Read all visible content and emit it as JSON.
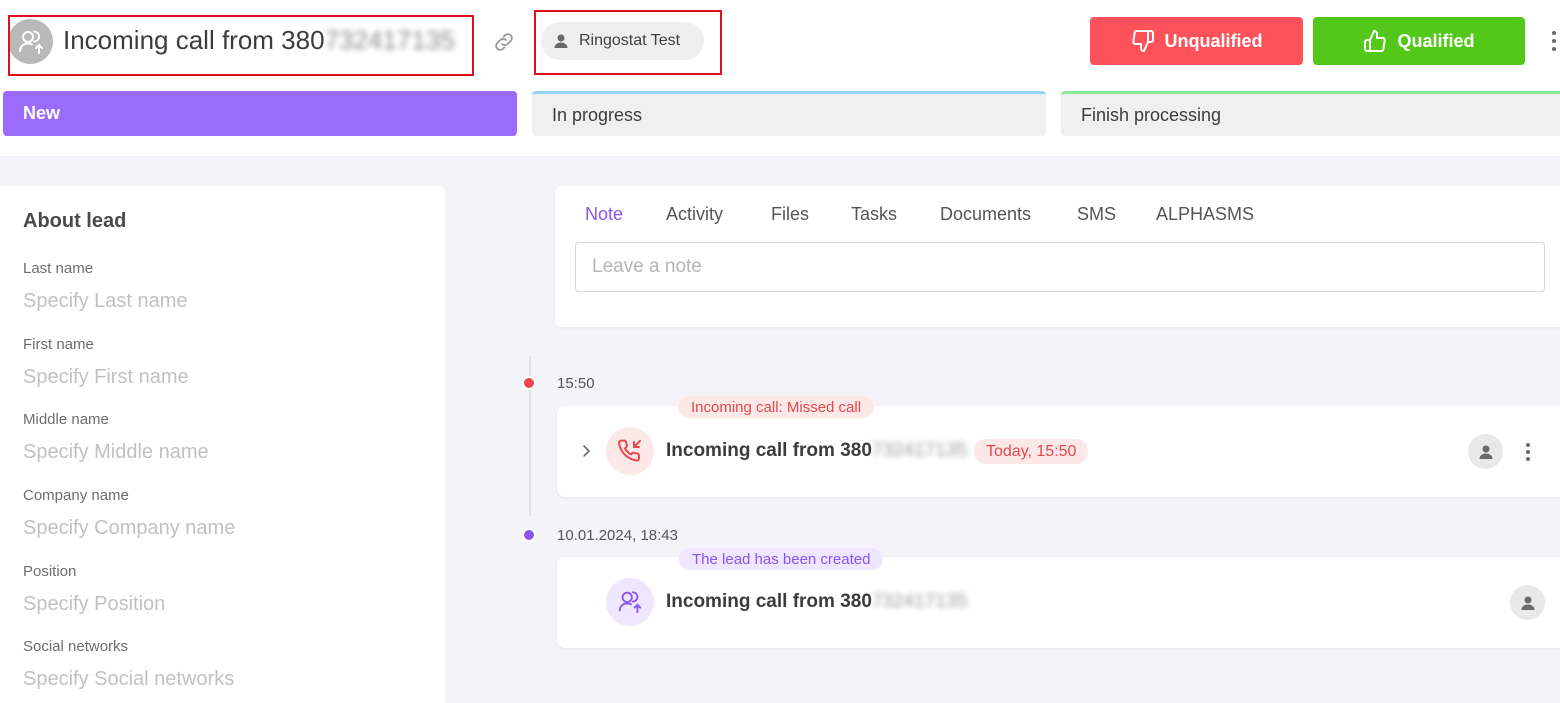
{
  "header": {
    "title": "Incoming call from 380",
    "title_masked": "732417135",
    "avatar_icon": "user-incoming-icon",
    "link_icon": "link-icon",
    "responsible": "Ringostat Test",
    "unqualified_label": "Unqualified",
    "qualified_label": "Qualified",
    "colors": {
      "unqualified": "#fd525a",
      "qualified": "#54c818",
      "accent": "#9b6cfc"
    }
  },
  "pipeline": {
    "stages": [
      {
        "label": "New",
        "active": true
      },
      {
        "label": "In progress",
        "active": false
      },
      {
        "label": "Finish processing",
        "active": false
      }
    ]
  },
  "about": {
    "title": "About lead",
    "fields": [
      {
        "label": "Last name",
        "placeholder": "Specify Last name"
      },
      {
        "label": "First name",
        "placeholder": "Specify First name"
      },
      {
        "label": "Middle name",
        "placeholder": "Specify Middle name"
      },
      {
        "label": "Company name",
        "placeholder": "Specify Company name"
      },
      {
        "label": "Position",
        "placeholder": "Specify Position"
      },
      {
        "label": "Social networks",
        "placeholder": "Specify Social networks"
      }
    ]
  },
  "composer": {
    "tabs": [
      "Note",
      "Activity",
      "Files",
      "Tasks",
      "Documents",
      "SMS",
      "ALPHASMS"
    ],
    "active_tab": "Note",
    "placeholder": "Leave a note"
  },
  "timeline": {
    "events": [
      {
        "time": "15:50",
        "tag": "Incoming call: Missed call",
        "title": "Incoming call from 380",
        "title_masked": "732417135",
        "date_badge": "Today, 15:50",
        "icon": "missed-call-icon"
      },
      {
        "time": "10.01.2024, 18:43",
        "tag": "The lead has been created",
        "title": "Incoming call from 380",
        "title_masked": "732417135",
        "icon": "user-incoming-icon"
      }
    ]
  }
}
